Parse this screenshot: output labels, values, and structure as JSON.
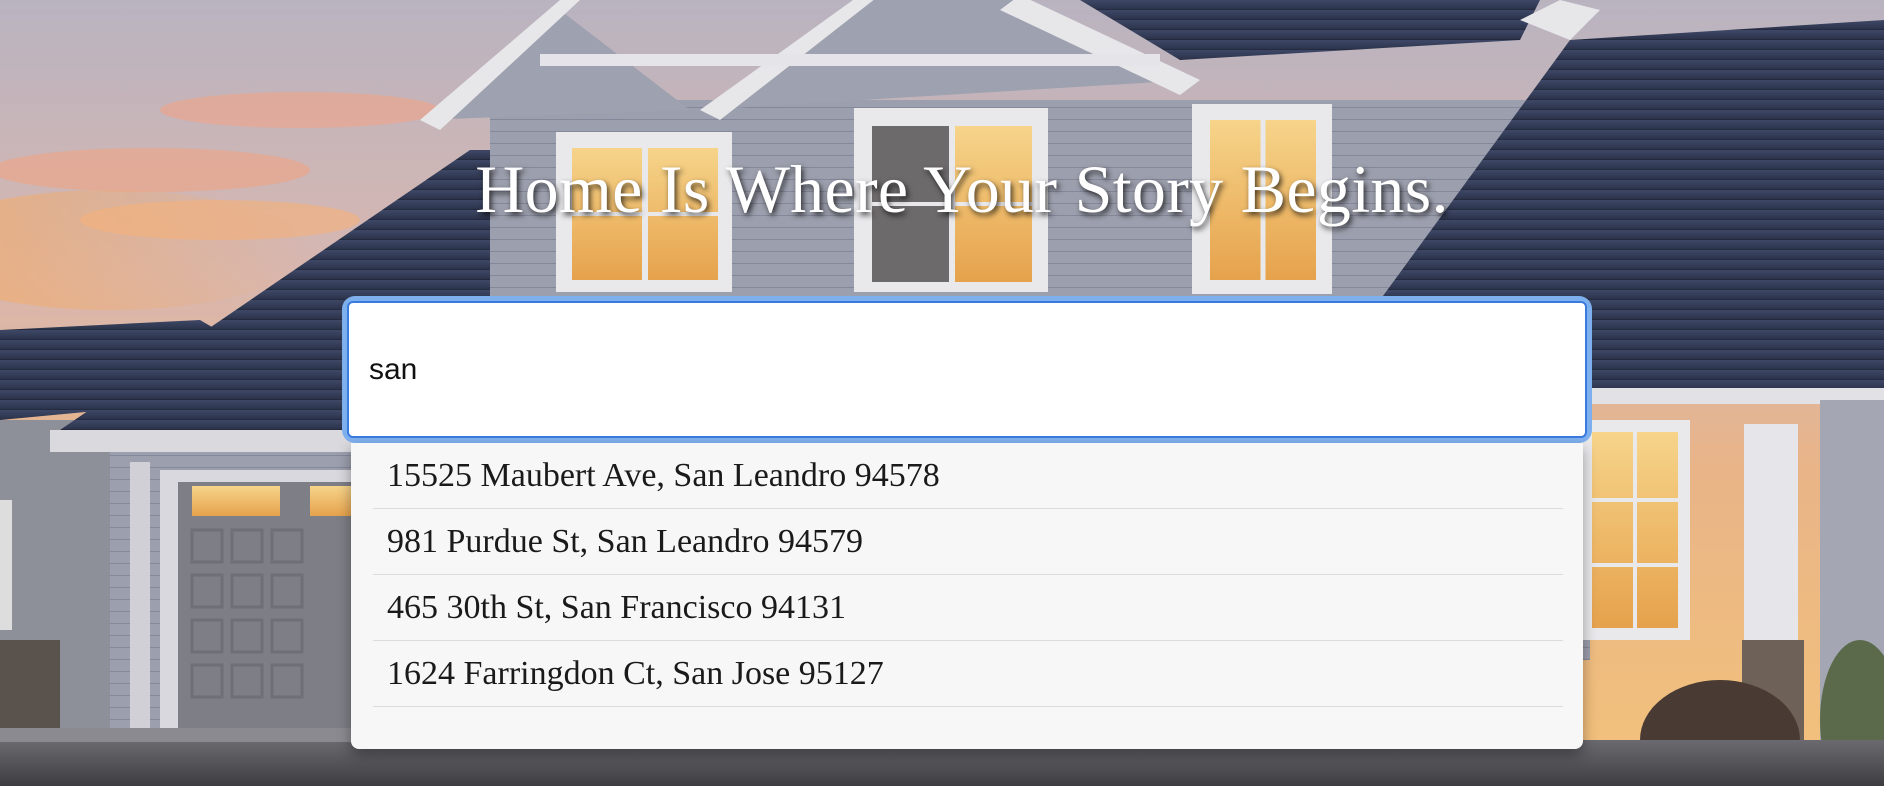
{
  "hero": {
    "title": "Home Is Where Your Story Begins."
  },
  "search": {
    "value": "san"
  },
  "suggestions": [
    "15525 Maubert Ave, San Leandro 94578",
    "981 Purdue St, San Leandro 94579",
    "465 30th St, San Francisco 94131",
    "1624 Farringdon Ct, San Jose 95127"
  ],
  "colors": {
    "focus_ring": "#7fb0ee",
    "input_border": "#3a7be0",
    "dropdown_bg": "#f7f7f7",
    "title_text": "#ffffff"
  },
  "background": {
    "icon": "house-at-dusk-photo"
  }
}
